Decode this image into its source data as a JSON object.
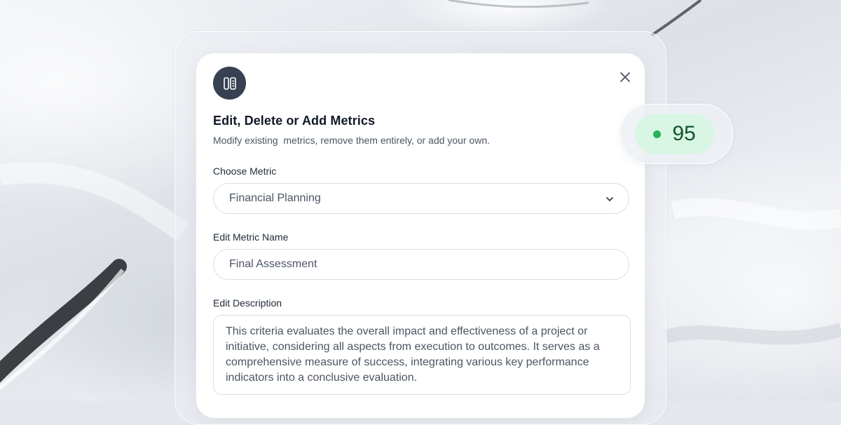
{
  "modal": {
    "icon": "columns-icon",
    "title": "Edit, Delete or Add Metrics",
    "subtitle": "Modify existing  metrics, remove them entirely, or add your own.",
    "close_icon": "close-icon"
  },
  "choose_metric": {
    "label": "Choose Metric",
    "selected": "Financial Planning",
    "icon": "chevron-down-icon"
  },
  "metric_name": {
    "label": "Edit Metric Name",
    "value": "Final Assessment"
  },
  "description": {
    "label": "Edit Description",
    "value": "This criteria evaluates the overall impact and effectiveness of a project or initiative, considering all aspects from execution to outcomes. It serves as a comprehensive measure of success, integrating various key performance indicators into a conclusive evaluation."
  },
  "score": {
    "value": "95",
    "status_color": "#22b457"
  }
}
